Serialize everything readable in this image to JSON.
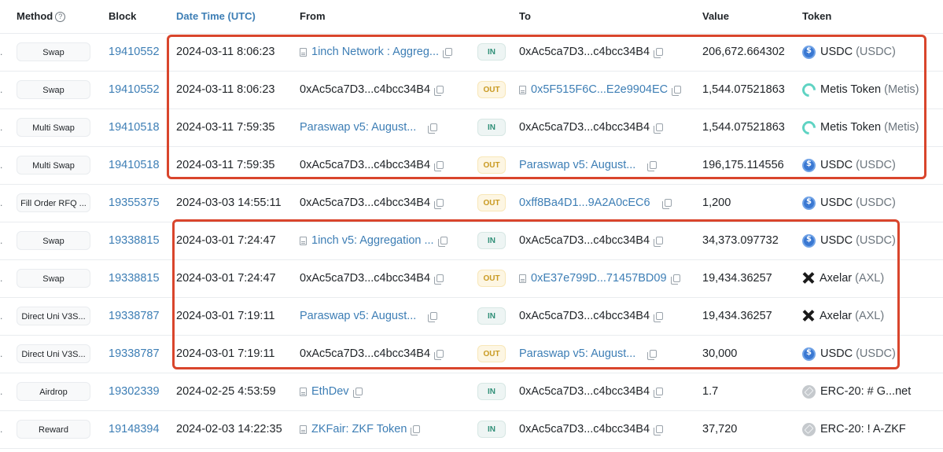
{
  "header": {
    "method": "Method",
    "method_help": "?",
    "block": "Block",
    "datetime": "Date Time (UTC)",
    "from": "From",
    "to": "To",
    "value": "Value",
    "token": "Token"
  },
  "colors": {
    "link": "#3d7eb5",
    "highlight_box": "#d9452c",
    "in_badge": "#2f8f77",
    "out_badge": "#c99a22"
  },
  "rows": [
    {
      "method": "Swap",
      "block": "19410552",
      "datetime": "2024-03-11 8:06:23",
      "from": "1inch Network : Aggreg...",
      "from_is_link": true,
      "from_contract": true,
      "direction": "IN",
      "to": "0xAc5ca7D3...c4bcc34B4",
      "to_is_link": false,
      "to_contract": false,
      "value": "206,672.664302",
      "token_icon": "usdc-icon",
      "token_name": "USDC",
      "token_symbol": "(USDC)"
    },
    {
      "method": "Swap",
      "block": "19410552",
      "datetime": "2024-03-11 8:06:23",
      "from": "0xAc5ca7D3...c4bcc34B4",
      "from_is_link": false,
      "from_contract": false,
      "direction": "OUT",
      "to": "0x5F515F6C...E2e9904EC",
      "to_is_link": true,
      "to_contract": true,
      "value": "1,544.07521863",
      "token_icon": "metis-icon",
      "token_name": "Metis Token",
      "token_symbol": "(Metis)"
    },
    {
      "method": "Multi Swap",
      "block": "19410518",
      "datetime": "2024-03-11 7:59:35",
      "from": "Paraswap v5: August...",
      "from_is_link": true,
      "from_contract": false,
      "direction": "IN",
      "to": "0xAc5ca7D3...c4bcc34B4",
      "to_is_link": false,
      "to_contract": false,
      "value": "1,544.07521863",
      "token_icon": "metis-icon",
      "token_name": "Metis Token",
      "token_symbol": "(Metis)"
    },
    {
      "method": "Multi Swap",
      "block": "19410518",
      "datetime": "2024-03-11 7:59:35",
      "from": "0xAc5ca7D3...c4bcc34B4",
      "from_is_link": false,
      "from_contract": false,
      "direction": "OUT",
      "to": "Paraswap v5: August...",
      "to_is_link": true,
      "to_contract": false,
      "value": "196,175.114556",
      "token_icon": "usdc-icon",
      "token_name": "USDC",
      "token_symbol": "(USDC)"
    },
    {
      "method": "Fill Order RFQ ...",
      "block": "19355375",
      "datetime": "2024-03-03 14:55:11",
      "from": "0xAc5ca7D3...c4bcc34B4",
      "from_is_link": false,
      "from_contract": false,
      "direction": "OUT",
      "to": "0xff8Ba4D1...9A2A0cEC6",
      "to_is_link": true,
      "to_contract": false,
      "value": "1,200",
      "token_icon": "usdc-icon",
      "token_name": "USDC",
      "token_symbol": "(USDC)"
    },
    {
      "method": "Swap",
      "block": "19338815",
      "datetime": "2024-03-01 7:24:47",
      "from": "1inch v5: Aggregation ...",
      "from_is_link": true,
      "from_contract": true,
      "direction": "IN",
      "to": "0xAc5ca7D3...c4bcc34B4",
      "to_is_link": false,
      "to_contract": false,
      "value": "34,373.097732",
      "token_icon": "usdc-icon",
      "token_name": "USDC",
      "token_symbol": "(USDC)"
    },
    {
      "method": "Swap",
      "block": "19338815",
      "datetime": "2024-03-01 7:24:47",
      "from": "0xAc5ca7D3...c4bcc34B4",
      "from_is_link": false,
      "from_contract": false,
      "direction": "OUT",
      "to": "0xE37e799D...71457BD09",
      "to_is_link": true,
      "to_contract": true,
      "value": "19,434.36257",
      "token_icon": "axelar-icon",
      "token_name": "Axelar",
      "token_symbol": "(AXL)"
    },
    {
      "method": "Direct Uni V3S...",
      "block": "19338787",
      "datetime": "2024-03-01 7:19:11",
      "from": "Paraswap v5: August...",
      "from_is_link": true,
      "from_contract": false,
      "direction": "IN",
      "to": "0xAc5ca7D3...c4bcc34B4",
      "to_is_link": false,
      "to_contract": false,
      "value": "19,434.36257",
      "token_icon": "axelar-icon",
      "token_name": "Axelar",
      "token_symbol": "(AXL)"
    },
    {
      "method": "Direct Uni V3S...",
      "block": "19338787",
      "datetime": "2024-03-01 7:19:11",
      "from": "0xAc5ca7D3...c4bcc34B4",
      "from_is_link": false,
      "from_contract": false,
      "direction": "OUT",
      "to": "Paraswap v5: August...",
      "to_is_link": true,
      "to_contract": false,
      "value": "30,000",
      "token_icon": "usdc-icon",
      "token_name": "USDC",
      "token_symbol": "(USDC)"
    },
    {
      "method": "Airdrop",
      "block": "19302339",
      "datetime": "2024-02-25 4:53:59",
      "from": "EthDev",
      "from_is_link": true,
      "from_contract": true,
      "direction": "IN",
      "to": "0xAc5ca7D3...c4bcc34B4",
      "to_is_link": false,
      "to_contract": false,
      "value": "1.7",
      "token_icon": "erc20-icon",
      "token_name": "ERC-20: # G...net",
      "token_symbol": ""
    },
    {
      "method": "Reward",
      "block": "19148394",
      "datetime": "2024-02-03 14:22:35",
      "from": "ZKFair: ZKF Token",
      "from_is_link": true,
      "from_contract": true,
      "direction": "IN",
      "to": "0xAc5ca7D3...c4bcc34B4",
      "to_is_link": false,
      "to_contract": false,
      "value": "37,720",
      "token_icon": "erc20-icon",
      "token_name": "ERC-20: ! A-ZKF",
      "token_symbol": ""
    }
  ]
}
